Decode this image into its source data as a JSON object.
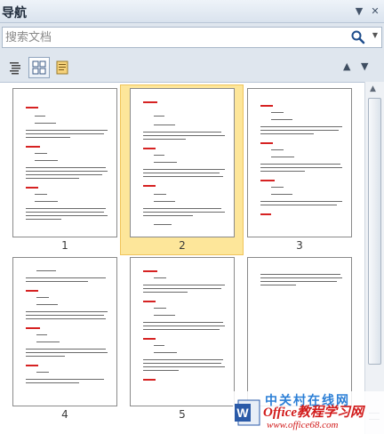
{
  "panel": {
    "title": "导航",
    "dropdown_glyph": "▼",
    "close_glyph": "✕"
  },
  "search": {
    "placeholder": "搜索文档",
    "icon": "magnifier-icon"
  },
  "tabs": [
    {
      "name": "tab-headings",
      "icon": "headings-list-icon",
      "active": false
    },
    {
      "name": "tab-pages",
      "icon": "page-grid-icon",
      "active": true
    },
    {
      "name": "tab-results",
      "icon": "results-doc-icon",
      "active": false
    }
  ],
  "nav": {
    "prev": "▲",
    "next": "▼"
  },
  "pages": [
    {
      "number": "1",
      "selected": false
    },
    {
      "number": "2",
      "selected": true
    },
    {
      "number": "3",
      "selected": false
    },
    {
      "number": "4",
      "selected": false
    },
    {
      "number": "5",
      "selected": false
    },
    {
      "number": "",
      "selected": false
    }
  ],
  "watermark": {
    "chinese": "中关村在线网",
    "main": "Office教程学习网",
    "url": "www.office68.com"
  },
  "colors": {
    "selected_page": "#fde69a",
    "heading_red": "#d62222",
    "panel_bg": "#dfe6ee"
  }
}
